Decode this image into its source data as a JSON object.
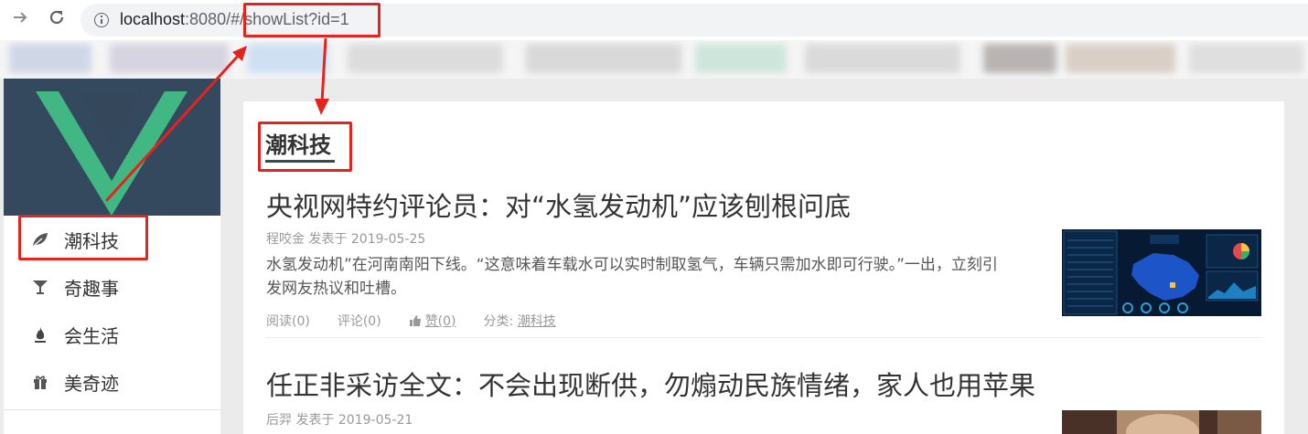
{
  "browser": {
    "url_host": "localhost",
    "url_rest": ":8080/#/showList?id=1",
    "back_icon": "arrow-right-icon",
    "reload_icon": "reload-icon"
  },
  "sidebar": {
    "items": [
      {
        "label": "潮科技",
        "icon": "leaf-icon"
      },
      {
        "label": "奇趣事",
        "icon": "goblet-icon"
      },
      {
        "label": "会生活",
        "icon": "flame-icon"
      },
      {
        "label": "美奇迹",
        "icon": "gift-icon"
      }
    ]
  },
  "content": {
    "section_title": "潮科技",
    "articles": [
      {
        "title": "央视网特约评论员：对“水氢发动机”应该刨根问底",
        "author": "程咬金",
        "posted": "发表于 2019-05-25",
        "desc": "水氢发动机”在河南南阳下线。“这意味着车载水可以实时制取氢气，车辆只需加水即可行驶。”一出，立刻引发网友热议和吐槽。",
        "reads": "阅读(0)",
        "comments": "评论(0)",
        "likes": "赞(0)",
        "category_label": "分类:",
        "category": "潮科技"
      },
      {
        "title": "任正非采访全文：不会出现断供，勿煽动民族情绪，家人也用苹果",
        "author": "后羿",
        "posted": "发表于 2019-05-21"
      }
    ]
  },
  "colors": {
    "annotation_red": "#e4231e",
    "vue_green": "#41b883",
    "vue_dark": "#35495e",
    "underline": "#2f4f4f"
  }
}
